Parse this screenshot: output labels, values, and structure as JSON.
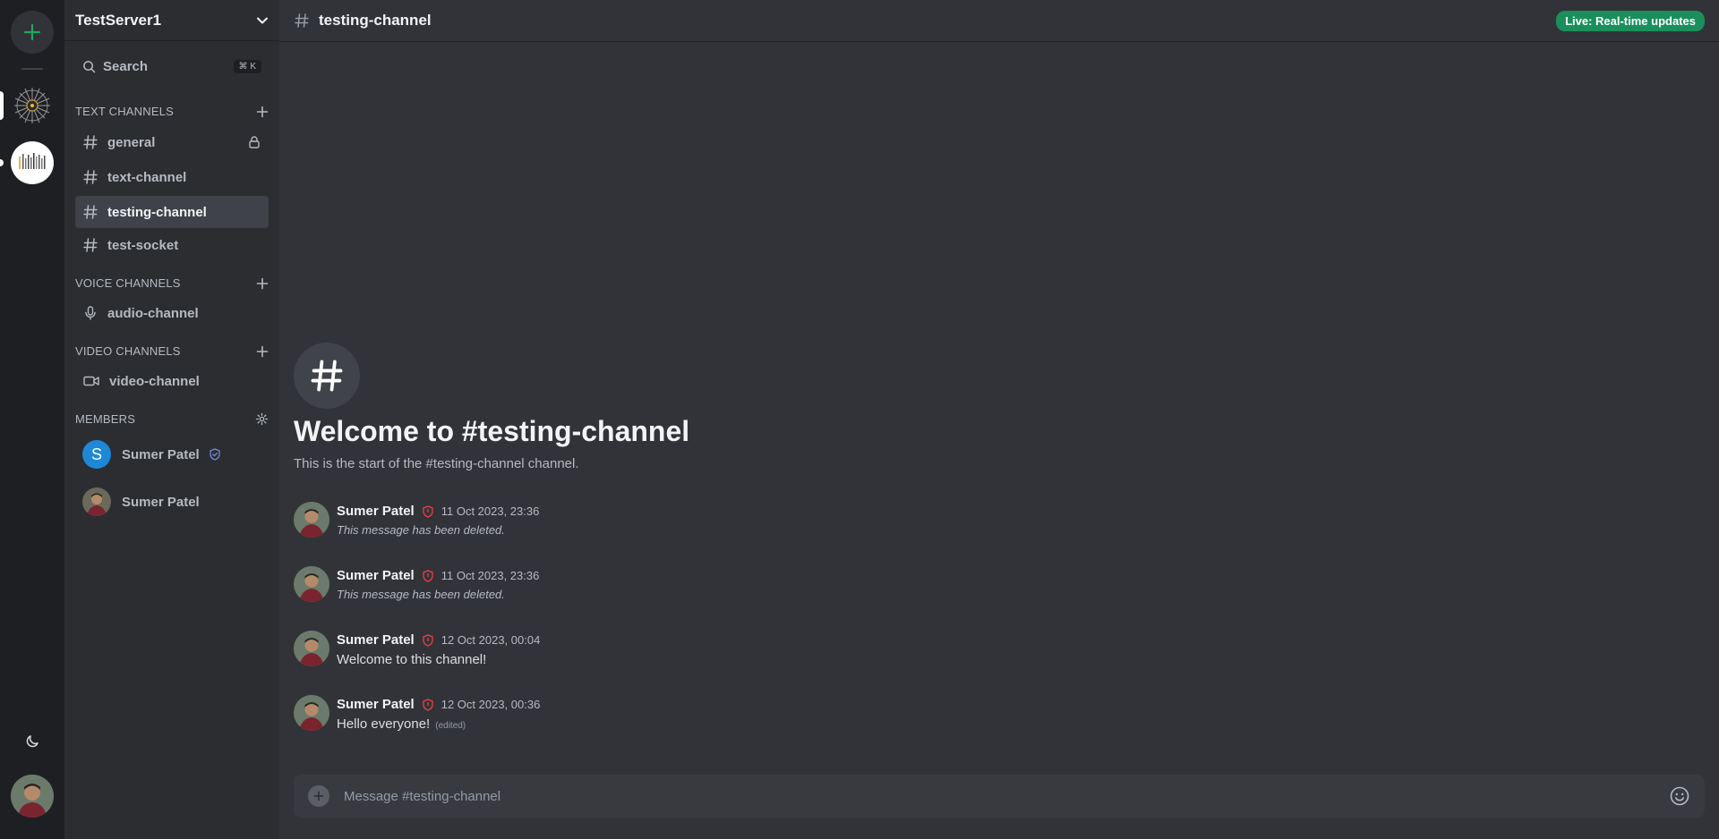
{
  "server": {
    "name": "TestServer1"
  },
  "search": {
    "label": "Search",
    "shortcut": "⌘ K"
  },
  "sections": {
    "text": "TEXT CHANNELS",
    "voice": "VOICE CHANNELS",
    "video": "VIDEO CHANNELS",
    "members": "MEMBERS"
  },
  "text_channels": [
    {
      "name": "general",
      "locked": true
    },
    {
      "name": "text-channel"
    },
    {
      "name": "testing-channel",
      "active": true
    },
    {
      "name": "test-socket"
    }
  ],
  "voice_channels": [
    {
      "name": "audio-channel"
    }
  ],
  "video_channels": [
    {
      "name": "video-channel"
    }
  ],
  "members": [
    {
      "name": "Sumer Patel",
      "initial": "S",
      "avatar_color": "#1e87d6",
      "badge": "shield-check"
    },
    {
      "name": "Sumer Patel",
      "avatar": "photo"
    }
  ],
  "header": {
    "channel": "testing-channel",
    "live_badge": "Live: Real-time updates"
  },
  "welcome": {
    "title": "Welcome to #testing-channel",
    "subtitle": "This is the start of the #testing-channel channel."
  },
  "messages": [
    {
      "author": "Sumer Patel",
      "timestamp": "11 Oct 2023, 23:36",
      "content": "This message has been deleted.",
      "deleted": true
    },
    {
      "author": "Sumer Patel",
      "timestamp": "11 Oct 2023, 23:36",
      "content": "This message has been deleted.",
      "deleted": true
    },
    {
      "author": "Sumer Patel",
      "timestamp": "12 Oct 2023, 00:04",
      "content": "Welcome to this channel!"
    },
    {
      "author": "Sumer Patel",
      "timestamp": "12 Oct 2023, 00:36",
      "content": "Hello everyone!",
      "edited": "(edited)"
    }
  ],
  "composer": {
    "placeholder": "Message #testing-channel"
  },
  "colors": {
    "accent_green": "#23a55a",
    "live_badge": "#1a8f5c",
    "admin_shield": "#f23f43",
    "mod_shield": "#7289da"
  }
}
